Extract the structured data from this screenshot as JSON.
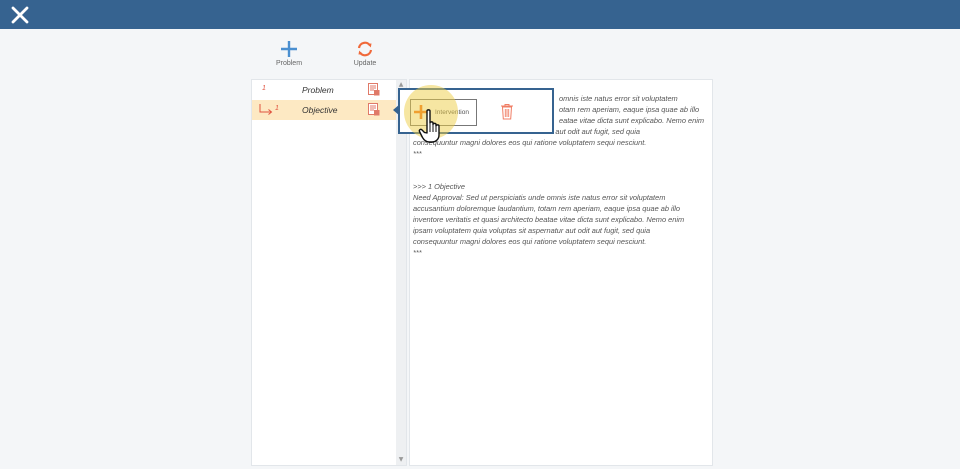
{
  "header": {
    "close_icon": "close-icon",
    "color": "#366390"
  },
  "toolbar": {
    "problem": {
      "label": "Problem",
      "icon": "plus-icon"
    },
    "update": {
      "label": "Update",
      "icon": "refresh-icon"
    }
  },
  "tree": {
    "items": [
      {
        "num": "1",
        "label": "Problem",
        "icon": "note-icon",
        "selected": false
      },
      {
        "num": "1",
        "label": "Objective",
        "icon": "note-icon",
        "selected": true
      }
    ]
  },
  "popup": {
    "intervention_label": "Intervention",
    "delete_icon": "trash-icon"
  },
  "content": {
    "hidden_lines": [
      "omnis iste natus error sit voluptatem",
      "otam rem aperiam, eaque ipsa quae ab illo",
      "eatae vitae dicta sunt explicabo. Nemo enim",
      "rnatur aut odit aut fugit, sed quia"
    ],
    "block1_tail": [
      "consequuntur magni dolores eos qui ratione voluptatem sequi nesciunt.",
      "***"
    ],
    "block2": [
      ">>> 1 Objective",
      "Need Approval: Sed ut perspiciatis unde omnis iste natus error sit voluptatem",
      "accusantium doloremque laudantium, totam rem aperiam, eaque ipsa quae ab illo",
      "inventore veritatis et quasi architecto beatae vitae dicta sunt explicabo. Nemo enim",
      "ipsam voluptatem quia voluptas sit aspernatur aut odit aut fugit, sed quia",
      "consequuntur magni dolores eos qui ratione voluptatem sequi nesciunt.",
      "***"
    ]
  }
}
